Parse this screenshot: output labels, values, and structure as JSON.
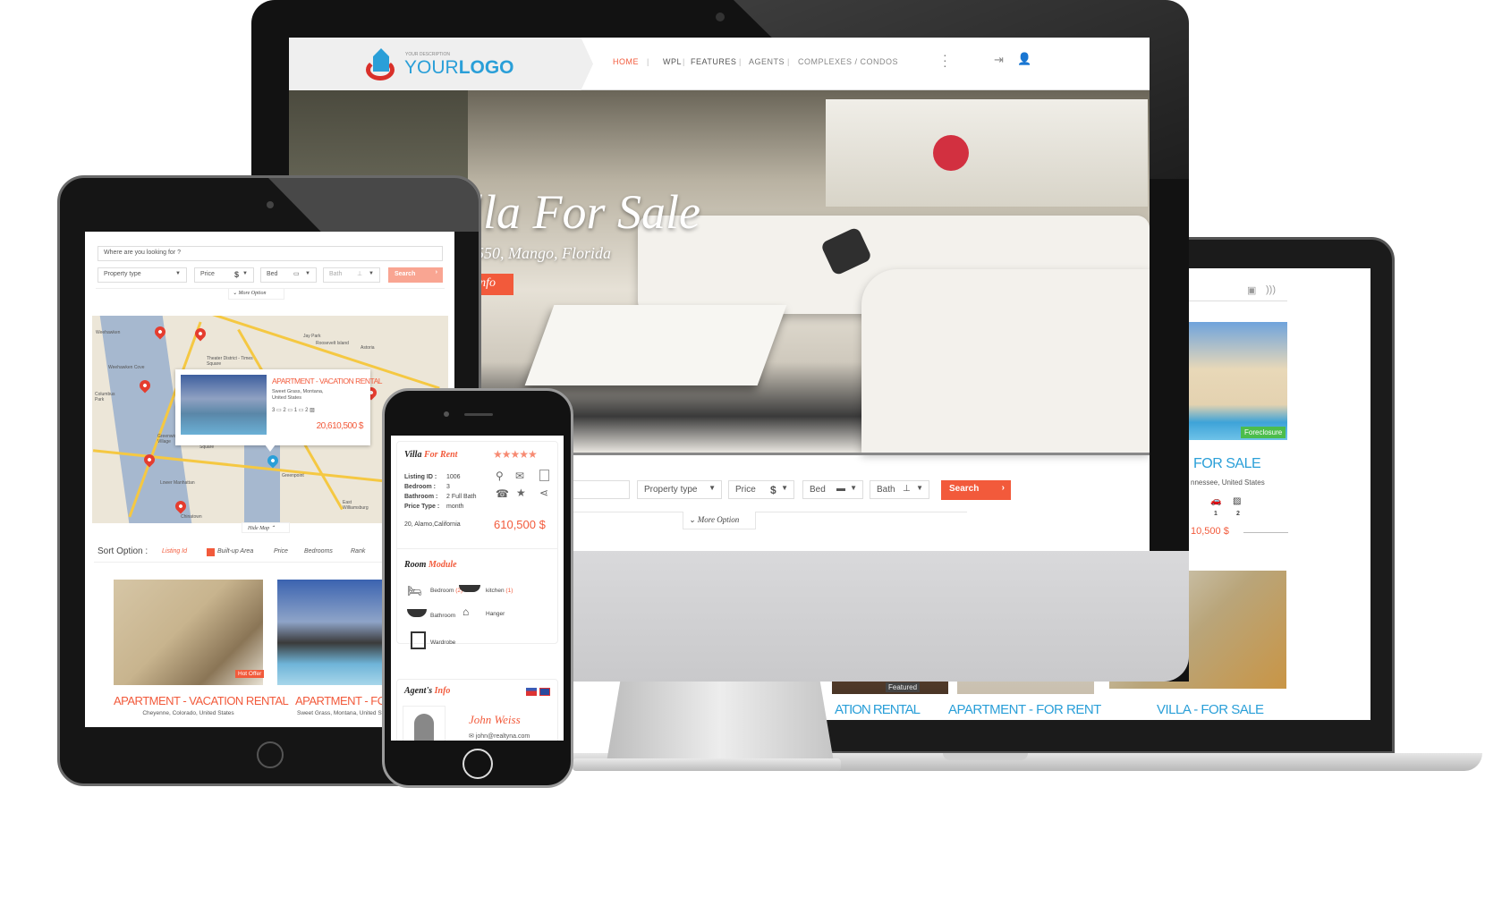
{
  "colors": {
    "accent": "#f25a3b",
    "blue": "#2a9fd8",
    "green": "#4cbd4c"
  },
  "desktop": {
    "logo": {
      "description": "YOUR DESCRIPTION",
      "text_a": "YOUR",
      "text_b": "LOGO"
    },
    "nav": [
      {
        "label": "HOME",
        "active": true
      },
      {
        "label": "WPL"
      },
      {
        "label": "FEATURES"
      },
      {
        "label": "AGENTS"
      },
      {
        "label": "COMPLEXES / CONDOS"
      }
    ],
    "icons": [
      "more-vertical-icon",
      "login-icon",
      "user-icon"
    ],
    "hero": {
      "title": "Villa For Sale",
      "subtitle": "33550, Mango, Florida",
      "button": "Info"
    },
    "search": {
      "property_type": "Property type",
      "price": "Price",
      "price_symbol": "$",
      "bed": "Bed",
      "bath": "Bath",
      "button": "Search",
      "more": "More Option"
    }
  },
  "laptop": {
    "toolbar_icons": [
      "save-icon",
      "rss-icon"
    ],
    "featured_card": {
      "badge": "Foreclosure",
      "title": "FOR SALE",
      "address": "nnessee, United States",
      "counts": [
        "1",
        "2"
      ],
      "price": "10,500 $"
    },
    "row": [
      {
        "title": "ATION RENTAL",
        "badge": "Featured"
      },
      {
        "title": "APARTMENT - FOR RENT"
      },
      {
        "title": "VILLA - FOR SALE"
      }
    ]
  },
  "tablet": {
    "search": {
      "placeholder": "Where are you looking for ?",
      "property_type": "Property type",
      "price": "Price",
      "price_symbol": "$",
      "bed": "Bed",
      "bath": "Bath",
      "button": "Search",
      "more": "More Option"
    },
    "map": {
      "labels": [
        "Weehawken",
        "Weehawken Cove",
        "Columbus Park",
        "Theater District - Times Square",
        "Roosevelt Island",
        "Astoria",
        "Greenwich Village",
        "Union Square",
        "Lower Manhattan",
        "Chinatown",
        "Greenpoint",
        "East Williamsburg",
        "Jay Park"
      ],
      "popup": {
        "title": "APARTMENT - VACATION RENTAL",
        "address_line1": "Sweet Grass, Montana,",
        "address_line2": "United States",
        "counts": [
          "3",
          "2",
          "1",
          "2"
        ],
        "price": "20,610,500 $"
      },
      "hide": "Hide Map"
    },
    "sort": {
      "label": "Sort Option :",
      "options": [
        "Listing Id",
        "Built-up Area",
        "Price",
        "Bedrooms",
        "Rank"
      ]
    },
    "listings": [
      {
        "title": "APARTMENT - VACATION RENTAL",
        "address": "Cheyenne, Colorado, United States",
        "badge": "Hot Offer"
      },
      {
        "title": "APARTMENT - FOR RENT",
        "address": "Sweet Grass, Montana, United States"
      }
    ]
  },
  "phone": {
    "title_a": "Villa",
    "title_b": "For Rent",
    "rating": 5,
    "stars": "★★★★★",
    "details": [
      {
        "label": "Listing ID :",
        "value": "1006"
      },
      {
        "label": "Bedroom :",
        "value": "3"
      },
      {
        "label": "Bathroom :",
        "value": "2 Full Bath"
      },
      {
        "label": "Price Type :",
        "value": "month"
      }
    ],
    "address": "20, Alamo,California",
    "price": "610,500 $",
    "room_title_a": "Room",
    "room_title_b": "Module",
    "rooms": [
      {
        "label": "Bedroom",
        "count": "(2)"
      },
      {
        "label": "kitchen",
        "count": "(1)"
      },
      {
        "label": "Bathroom"
      },
      {
        "label": "Hanger"
      },
      {
        "label": "Wardrobe"
      }
    ],
    "agent_title_a": "Agent's",
    "agent_title_b": "Info",
    "agent": {
      "name": "John Weiss",
      "email": "john@realtyna.com"
    }
  }
}
